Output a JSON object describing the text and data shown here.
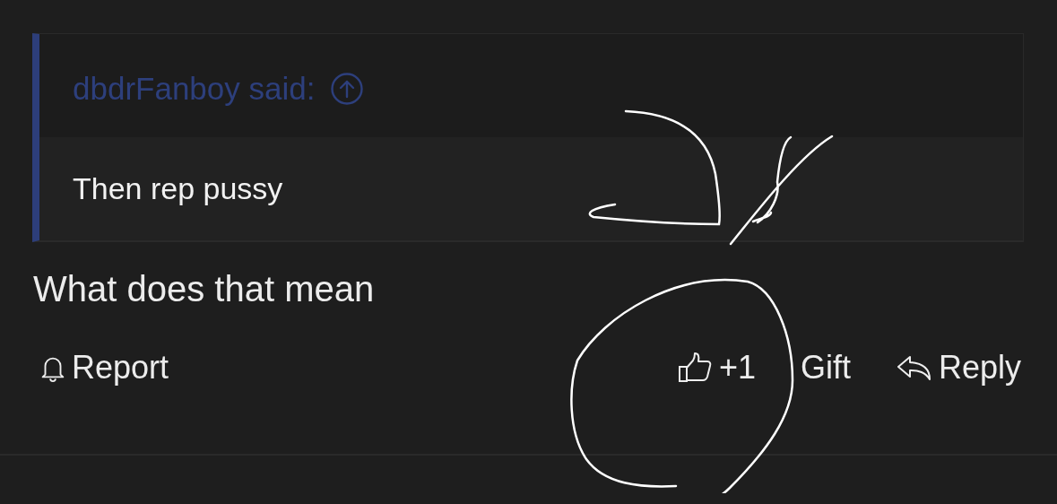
{
  "quote": {
    "author": "dbdrFanboy said:",
    "text": "Then rep pussy"
  },
  "post": {
    "text": "What does that mean"
  },
  "actions": [
    {
      "kind": "report",
      "label": "Report"
    },
    {
      "kind": "like",
      "label": "+1"
    },
    {
      "kind": "gift",
      "label": "Gift"
    },
    {
      "kind": "reply",
      "label": "Reply"
    }
  ]
}
